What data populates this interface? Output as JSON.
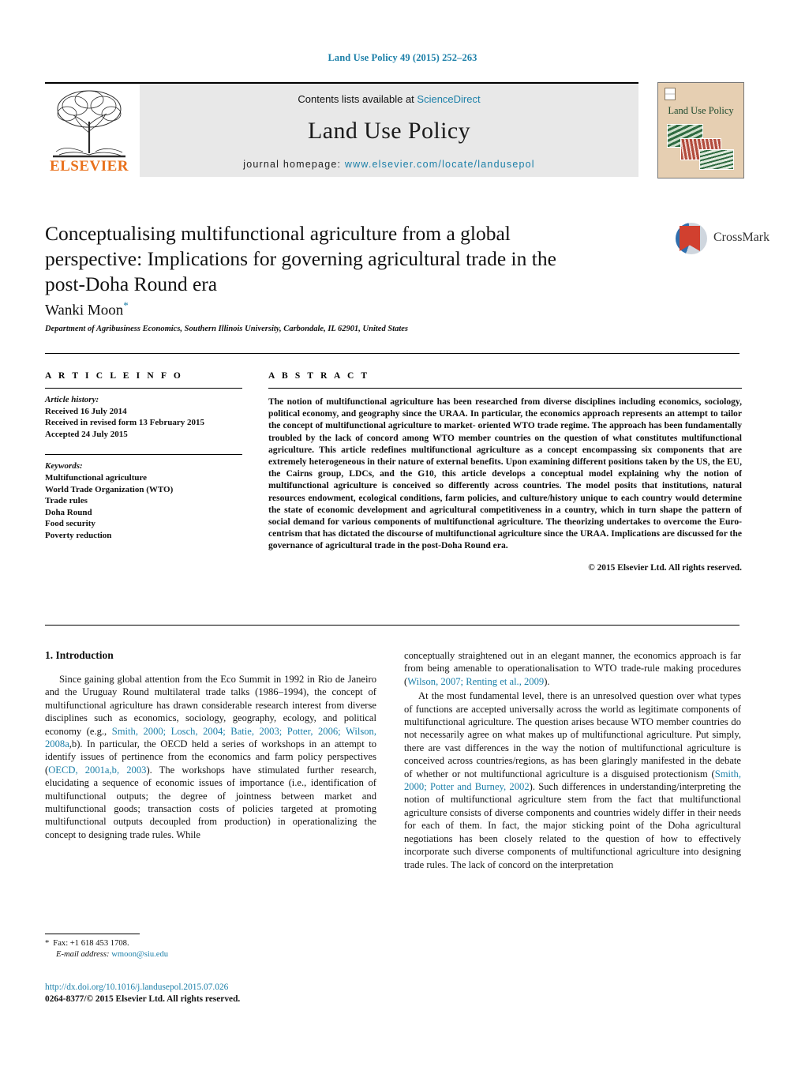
{
  "running_head": "Land Use Policy 49 (2015) 252–263",
  "journal_header": {
    "contents_prefix": "Contents lists available at ",
    "sciencedirect": "ScienceDirect",
    "journal_title": "Land Use Policy",
    "homepage_label": "journal homepage: ",
    "homepage_url": "www.elsevier.com/locate/landusepol",
    "publisher": "ELSEVIER",
    "cover_title": "Land Use Policy",
    "accent_color": "#1b7fa8",
    "elsevier_orange": "#E9711C"
  },
  "article": {
    "title": "Conceptualising multifunctional agriculture from a global perspective: Implications for governing agricultural trade in the post-Doha Round era",
    "crossmark_label": "CrossMark",
    "author": "Wanki Moon",
    "author_marker": "*",
    "affiliation": "Department of Agribusiness Economics, Southern Illinois University, Carbondale, IL 62901, United States"
  },
  "article_info": {
    "heading": "A R T I C L E   I N F O",
    "history_label": "Article history:",
    "history": [
      "Received 16 July 2014",
      "Received in revised form 13 February 2015",
      "Accepted 24 July 2015"
    ],
    "keywords_label": "Keywords:",
    "keywords": [
      "Multifunctional agriculture",
      "World Trade Organization (WTO)",
      "Trade rules",
      "Doha Round",
      "Food security",
      "Poverty reduction"
    ]
  },
  "abstract": {
    "heading": "A B S T R A C T",
    "text": "The notion of multifunctional agriculture has been researched from diverse disciplines including economics, sociology, political economy, and geography since the URAA. In particular, the economics approach represents an attempt to tailor the concept of multifunctional agriculture to market- oriented WTO trade regime. The approach has been fundamentally troubled by the lack of concord among WTO member countries on the question of what constitutes multifunctional agriculture. This article redefines multifunctional agriculture as a concept encompassing six components that are extremely heterogeneous in their nature of external benefits. Upon examining different positions taken by the US, the EU, the Cairns group, LDCs, and the G10, this article develops a conceptual model explaining why the notion of multifunctional agriculture is conceived so differently across countries. The model posits that institutions, natural resources endowment, ecological conditions, farm policies, and culture/history unique to each country would determine the state of economic development and agricultural competitiveness in a country, which in turn shape the pattern of social demand for various components of multifunctional agriculture. The theorizing undertakes to overcome the Euro- centrism that has dictated the discourse of multifunctional agriculture since the URAA. Implications are discussed for the governance of agricultural trade in the post-Doha Round era.",
    "copyright": "© 2015 Elsevier Ltd. All rights reserved."
  },
  "body": {
    "section_heading": "1. Introduction",
    "left_paragraph_1_a": "Since gaining global attention from the Eco Summit in 1992 in Rio de Janeiro and the Uruguay Round multilateral trade talks (1986–1994), the concept of multifunctional agriculture has drawn considerable research interest from diverse disciplines such as economics, sociology, geography, ecology, and political economy (e.g., ",
    "left_cite_1": "Smith, 2000; Losch, 2004; Batie, 2003; Potter, 2006; Wilson, 2008a",
    "left_paragraph_1_b": ",b). In particular, the OECD held a series of workshops in an attempt to identify issues of pertinence from the economics and farm policy perspectives (",
    "left_cite_2": "OECD, 2001a,b, 2003",
    "left_paragraph_1_c": "). The workshops have stimulated further research, elucidating a sequence of economic issues of importance (i.e., identification of multifunctional outputs; the degree of jointness between market and multifunctional goods; transaction costs of policies targeted at promoting multifunctional outputs decoupled from production) in operationalizing the concept to designing trade rules. While",
    "right_paragraph_1_a": "conceptually straightened out in an elegant manner, the economics approach is far from being amenable to operationalisation to WTO trade-rule making procedures (",
    "right_cite_1": "Wilson, 2007; Renting et al., 2009",
    "right_paragraph_1_b": ").",
    "right_paragraph_2_a": "At the most fundamental level, there is an unresolved question over what types of functions are accepted universally across the world as legitimate components of multifunctional agriculture. The question arises because WTO member countries do not necessarily agree on what makes up of multifunctional agriculture. Put simply, there are vast differences in the way the notion of multifunctional agriculture is conceived across countries/regions, as has been glaringly manifested in the debate of whether or not multifunctional agriculture is a disguised protectionism (",
    "right_cite_2": "Smith, 2000; Potter and Burney, 2002",
    "right_paragraph_2_b": "). Such differences in understanding/interpreting the notion of multifunctional agriculture stem from the fact that multifunctional agriculture consists of diverse components and countries widely differ in their needs for each of them. In fact, the major sticking point of the Doha agricultural negotiations has been closely related to the question of how to effectively incorporate such diverse components of multifunctional agriculture into designing trade rules. The lack of concord on the interpretation"
  },
  "footer": {
    "fax_marker": "*",
    "fax": "Fax: +1 618 453 1708.",
    "email_label": "E-mail address:",
    "email": "wmoon@siu.edu",
    "doi": "http://dx.doi.org/10.1016/j.landusepol.2015.07.026",
    "issn_line": "0264-8377/© 2015 Elsevier Ltd. All rights reserved."
  }
}
